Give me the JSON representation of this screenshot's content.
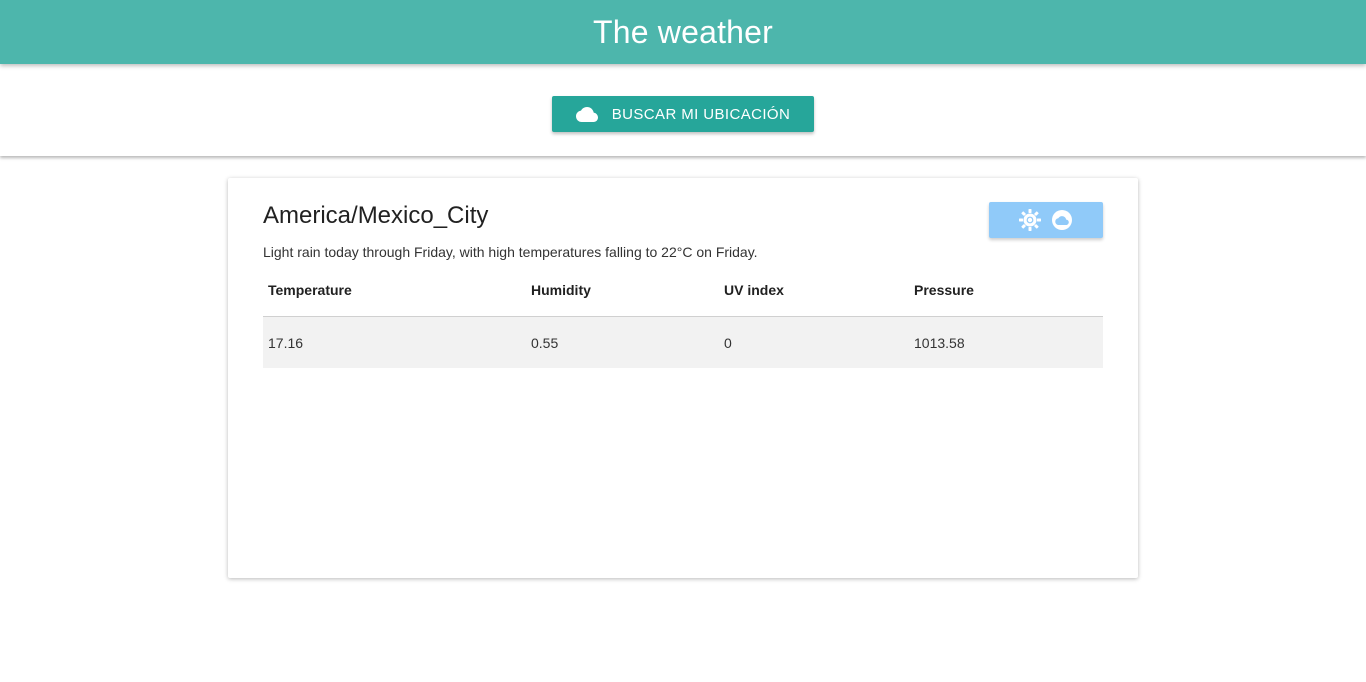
{
  "header": {
    "title": "The weather"
  },
  "locate": {
    "button_label": "BUSCAR MI UBICACIÓN",
    "icon": "cloud-icon"
  },
  "card": {
    "city": "America/Mexico_City",
    "summary": "Light rain today through Friday, with high temperatures falling to 22°C on Friday.",
    "unit_toggle": {
      "icons": [
        "sun-icon",
        "cloud-icon"
      ],
      "color": "#90caf9"
    },
    "table": {
      "columns": [
        "Temperature",
        "Humidity",
        "UV index",
        "Pressure"
      ],
      "rows": [
        [
          "17.16",
          "0.55",
          "0",
          "1013.58"
        ]
      ]
    }
  },
  "colors": {
    "header": "#4db6ac",
    "button": "#26a69a",
    "row_background": "#f2f2f2"
  }
}
